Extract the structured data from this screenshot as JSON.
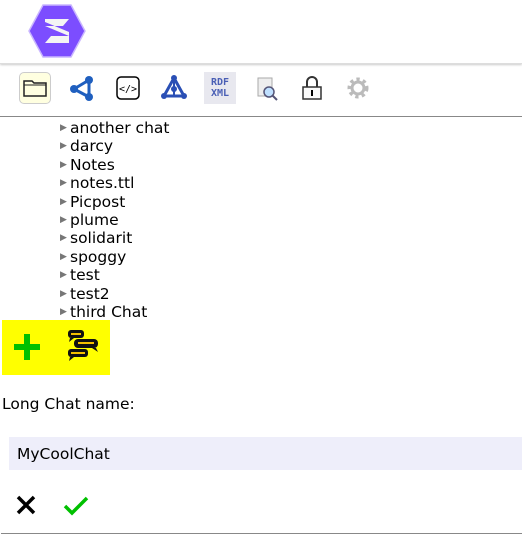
{
  "header": {
    "logo": "solid-logo"
  },
  "toolbar": {
    "icons": [
      "folder-icon",
      "network-icon",
      "code-icon",
      "graph-icon",
      "rdf-xml-icon",
      "search-document-icon",
      "lock-icon",
      "gear-icon"
    ],
    "rdf_top": "RDF",
    "rdf_bottom": "XML"
  },
  "tree": {
    "items": [
      "another chat",
      "darcy",
      "Notes",
      "notes.ttl",
      "Picpost",
      "plume",
      "solidarit",
      "spoggy",
      "test",
      "test2",
      "third Chat"
    ]
  },
  "actions": {
    "add": "add-icon",
    "chat": "chat-icon"
  },
  "form": {
    "label": "Long Chat name:",
    "value": "MyCoolChat"
  },
  "colors": {
    "accent": "#7c4dff",
    "highlight": "#ffff00",
    "green": "#00c000",
    "input_bg": "#eeeefa"
  }
}
